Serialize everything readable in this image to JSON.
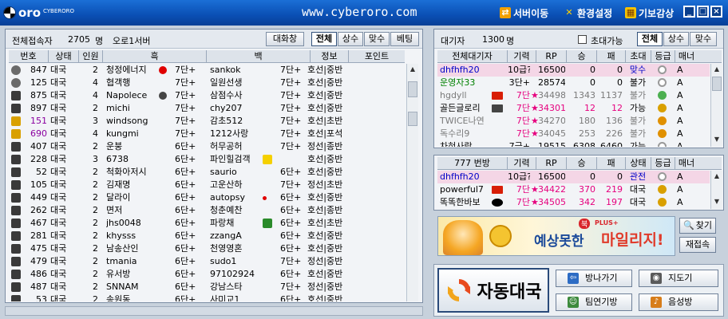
{
  "titlebar": {
    "logo_text": "oro",
    "logo_sub": "CYBERORO",
    "url": "www.cyberoro.com",
    "menu": [
      "서버이동",
      "환경설정",
      "기보감상"
    ],
    "win_buttons": [
      "_",
      "□",
      "×"
    ]
  },
  "colors": {
    "title_bg": "#0a4fb4",
    "pink_row": "#f4d6e6",
    "selected_row": "#f4d6e6",
    "id_blue": "#0000c8",
    "id_green": "#008000",
    "gray": "#7a7a7a",
    "star": "#e6007e"
  },
  "lobby": {
    "header": {
      "label": "전체접속자",
      "count": "2705",
      "unit": "명",
      "server": "오로1서버"
    },
    "tabs": [
      "대화창",
      "전체",
      "상수",
      "맞수",
      "베팅"
    ],
    "columns": [
      "번호",
      "상태",
      "인원",
      "흑",
      "백",
      "정보",
      "포인트"
    ],
    "rows": [
      {
        "icon": "gray-stack-icon",
        "num": "847",
        "status": "대국",
        "people": "2",
        "black": "청정에너지",
        "bflag": "clover-icon",
        "brank": "7단+",
        "white": "sankok",
        "wrank": "7단+",
        "info": "호선|중반"
      },
      {
        "icon": "gray-stack-icon",
        "num": "125",
        "status": "대국",
        "people": "4",
        "black": "협객행",
        "bflag": "",
        "brank": "7단+",
        "white": "일원선생",
        "wrank": "7단+",
        "info": "호선|중반"
      },
      {
        "icon": "lock-icon",
        "num": "875",
        "status": "대국",
        "people": "4",
        "black": "Napolece",
        "bflag": "phone-icon",
        "brank": "7단+",
        "white": "삼점수사",
        "wrank": "7단+",
        "info": "호선|중반"
      },
      {
        "icon": "lock-icon",
        "num": "897",
        "status": "대국",
        "people": "2",
        "black": "michi",
        "bflag": "",
        "brank": "7단+",
        "white": "chy207",
        "wrank": "7단+",
        "info": "호선|중반"
      },
      {
        "icon": "gold-lock-icon",
        "num": "151",
        "status": "대국",
        "people": "3",
        "black": "windsong",
        "bflag": "",
        "brank": "7단+",
        "white": "감초512",
        "wrank": "7단+",
        "info": "호선|초반",
        "nc": "#8a00a0"
      },
      {
        "icon": "gold-lock-icon",
        "num": "690",
        "status": "대국",
        "people": "4",
        "black": "kungmi",
        "bflag": "",
        "brank": "7단+",
        "white": "1212사랑",
        "wrank": "7단+",
        "info": "호선|포석",
        "nc": "#8a00a0"
      },
      {
        "icon": "lock-icon",
        "num": "407",
        "status": "대국",
        "people": "2",
        "black": "운붕",
        "bflag": "",
        "brank": "6단+",
        "white": "허무공허",
        "wrank": "7단+",
        "info": "정선|종반"
      },
      {
        "icon": "lock-icon",
        "num": "228",
        "status": "대국",
        "people": "3",
        "black": "6738",
        "bflag": "",
        "brank": "6단+",
        "white": "파인힐검객",
        "wrank": "",
        "info": "호선|중반",
        "wflag": "yellow-badge-icon"
      },
      {
        "icon": "lock-icon",
        "num": "52",
        "status": "대국",
        "people": "2",
        "black": "척화아저시",
        "bflag": "",
        "brank": "6단+",
        "white": "saurio",
        "wrank": "6단+",
        "info": "호선|중반"
      },
      {
        "icon": "lock-icon",
        "num": "105",
        "status": "대국",
        "people": "2",
        "black": "김재명",
        "bflag": "",
        "brank": "6단+",
        "white": "고운산하",
        "wrank": "7단+",
        "info": "정선|초반"
      },
      {
        "icon": "lock-icon",
        "num": "449",
        "status": "대국",
        "people": "2",
        "black": "달라이",
        "bflag": "",
        "brank": "6단+",
        "white": "autopsy",
        "wrank": "6단+",
        "info": "호선|중반",
        "wflag": "red-dot-icon"
      },
      {
        "icon": "lock-icon",
        "num": "262",
        "status": "대국",
        "people": "2",
        "black": "면저",
        "bflag": "",
        "brank": "6단+",
        "white": "청춘예찬",
        "wrank": "6단+",
        "info": "호선|종반"
      },
      {
        "icon": "lock-icon",
        "num": "467",
        "status": "대국",
        "people": "2",
        "black": "jhs0048",
        "bflag": "",
        "brank": "6단+",
        "white": "파랑채",
        "wrank": "6단+",
        "info": "호선|초반",
        "wflag": "green-leaf-icon"
      },
      {
        "icon": "lock-icon",
        "num": "281",
        "status": "대국",
        "people": "2",
        "black": "khysss",
        "bflag": "",
        "brank": "6단+",
        "white": "zzangA",
        "wrank": "6단+",
        "info": "호선|중반"
      },
      {
        "icon": "lock-icon",
        "num": "475",
        "status": "대국",
        "people": "2",
        "black": "남송산인",
        "bflag": "",
        "brank": "6단+",
        "white": "천영영혼",
        "wrank": "6단+",
        "info": "호선|중반"
      },
      {
        "icon": "lock-icon",
        "num": "479",
        "status": "대국",
        "people": "2",
        "black": "tmania",
        "bflag": "",
        "brank": "6단+",
        "white": "sudo1",
        "wrank": "7단+",
        "info": "정선|중반"
      },
      {
        "icon": "lock-icon",
        "num": "486",
        "status": "대국",
        "people": "2",
        "black": "유서방",
        "bflag": "",
        "brank": "6단+",
        "white": "97102924",
        "wrank": "6단+",
        "info": "호선|중반"
      },
      {
        "icon": "lock-icon",
        "num": "487",
        "status": "대국",
        "people": "2",
        "black": "SNNAM",
        "bflag": "",
        "brank": "6단+",
        "white": "강남스타",
        "wrank": "7단+",
        "info": "정선|중반"
      },
      {
        "icon": "lock-icon",
        "num": "53",
        "status": "대국",
        "people": "2",
        "black": "송원동",
        "bflag": "",
        "brank": "6단+",
        "white": "사미교1",
        "wrank": "6단+",
        "info": "호선|중반"
      }
    ]
  },
  "waiting": {
    "header": {
      "label": "대기자",
      "count": "1300",
      "unit": "명"
    },
    "checkbox_label": "초대가능",
    "tabs": [
      "전체",
      "상수",
      "맞수"
    ],
    "columns": [
      "전체대기자",
      "기력",
      "RP",
      "승",
      "패",
      "초대",
      "등급",
      "매너"
    ],
    "rows": [
      {
        "name": "dhfhfh20",
        "flag": "",
        "rank": "10급?",
        "rp": "16500",
        "win": "0",
        "lose": "0",
        "invite": "맞수",
        "grade": "ring-icon",
        "manner": "A",
        "color": "#0000c8",
        "selected": true
      },
      {
        "name": "운영자33",
        "flag": "",
        "rank": "3단+",
        "rp": "28574",
        "win": "0",
        "lose": "0",
        "invite": "불가",
        "grade": "ring-icon",
        "manner": "A",
        "color": "#008000"
      },
      {
        "name": "hgdyll",
        "flag": "china-flag-icon",
        "rank": "7단",
        "rp": "34498",
        "win": "1343",
        "lose": "1137",
        "invite": "불가",
        "grade": "heart-icon",
        "manner": "A",
        "color": "#7a7a7a",
        "star": true
      },
      {
        "name": "골든글로리",
        "flag": "phone-icon",
        "rank": "7단",
        "rp": "34301",
        "win": "12",
        "lose": "12",
        "invite": "가능",
        "grade": "bell-icon",
        "manner": "A",
        "color": "#000",
        "star": true
      },
      {
        "name": "TWICE나연",
        "flag": "",
        "rank": "7단",
        "rp": "34270",
        "win": "180",
        "lose": "136",
        "invite": "불가",
        "grade": "crown-icon",
        "manner": "A",
        "color": "#7a7a7a",
        "star": true
      },
      {
        "name": "독수리9",
        "flag": "",
        "rank": "7단",
        "rp": "34045",
        "win": "253",
        "lose": "226",
        "invite": "불가",
        "grade": "crown-icon",
        "manner": "A",
        "color": "#7a7a7a",
        "star": true
      },
      {
        "name": "차혀사랑",
        "flag": "",
        "rank": "7급+",
        "rp": "19515",
        "win": "6308",
        "lose": "6460",
        "invite": "가능",
        "grade": "ring-icon",
        "manner": "A",
        "color": "#000"
      }
    ]
  },
  "room": {
    "columns": [
      "777 번방",
      "기력",
      "RP",
      "승",
      "패",
      "상태",
      "등급",
      "매너"
    ],
    "rows": [
      {
        "name": "dhfhfh20",
        "flag": "",
        "rank": "10급?",
        "rp": "16500",
        "win": "0",
        "lose": "0",
        "state": "관전",
        "grade": "ring-icon",
        "manner": "A",
        "color": "#0000c8",
        "selected": true
      },
      {
        "name": "powerful7",
        "flag": "china-flag-icon",
        "rank": "7단",
        "rp": "34422",
        "win": "370",
        "lose": "219",
        "state": "대국",
        "grade": "medal-icon",
        "manner": "A",
        "color": "#000",
        "star": true
      },
      {
        "name": "똑똑한바보",
        "flag": "black-stone-icon",
        "rank": "7단",
        "rp": "34505",
        "win": "342",
        "lose": "197",
        "state": "대국",
        "grade": "medal-icon",
        "manner": "A",
        "color": "#000",
        "star": true
      }
    ]
  },
  "banner": {
    "tag": "북",
    "plus": "PLUS+",
    "text": "예상못한",
    "highlight": "마일리지!"
  },
  "side_buttons": {
    "find": "찾기",
    "reconnect": "재접속"
  },
  "actions": {
    "auto": "자동대국",
    "make_room": "방나가기",
    "tutor": "지도기",
    "team": "팀연기방",
    "voice": "음성방"
  }
}
